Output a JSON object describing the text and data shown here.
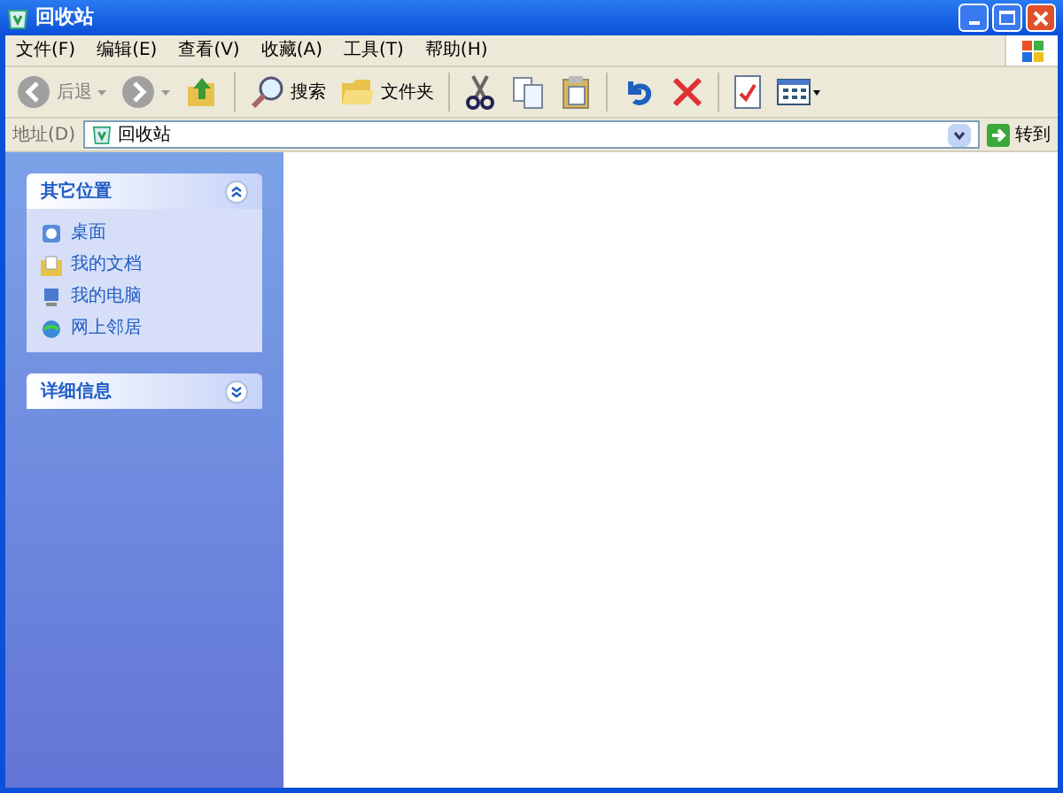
{
  "window": {
    "title": "回收站"
  },
  "menu": [
    "文件(F)",
    "编辑(E)",
    "查看(V)",
    "收藏(A)",
    "工具(T)",
    "帮助(H)"
  ],
  "toolbar": [
    {
      "kind": "back",
      "label": "后退",
      "disabled": true
    },
    {
      "kind": "forward",
      "disabled": true
    },
    {
      "kind": "up",
      "disabled": false
    },
    {
      "kind": "sep"
    },
    {
      "kind": "search",
      "label": "搜索",
      "disabled": false
    },
    {
      "kind": "folders",
      "label": "文件夹",
      "disabled": false
    },
    {
      "kind": "sep"
    },
    {
      "kind": "cut",
      "disabled": false
    },
    {
      "kind": "copy",
      "disabled": false
    },
    {
      "kind": "paste",
      "disabled": false
    },
    {
      "kind": "sep"
    },
    {
      "kind": "undo",
      "disabled": false
    },
    {
      "kind": "delete",
      "disabled": false
    },
    {
      "kind": "sep"
    },
    {
      "kind": "properties",
      "disabled": false
    },
    {
      "kind": "views",
      "disabled": false
    }
  ],
  "address": {
    "label": "地址(D)",
    "value": "回收站",
    "go": "转到"
  },
  "sidebar": [
    {
      "title": "其它位置",
      "expanded": true,
      "items": [
        {
          "kind": "desktop",
          "label": "桌面"
        },
        {
          "kind": "documents",
          "label": "我的文档"
        },
        {
          "kind": "computer",
          "label": "我的电脑"
        },
        {
          "kind": "network",
          "label": "网上邻居"
        }
      ]
    },
    {
      "title": "详细信息",
      "expanded": false
    }
  ]
}
